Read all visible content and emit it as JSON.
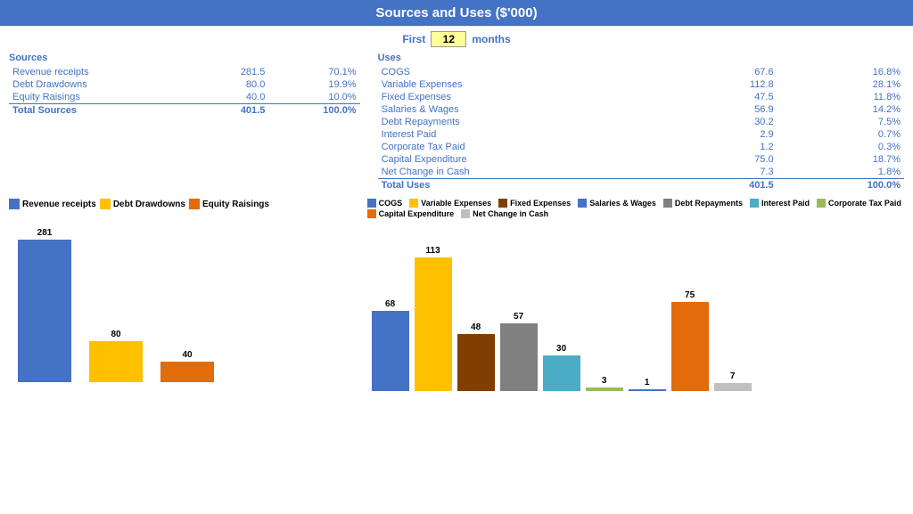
{
  "title": "Sources and Uses ($'000)",
  "months_label_first": "First",
  "months_value": "12",
  "months_label_after": "months",
  "sources": {
    "title": "Sources",
    "rows": [
      {
        "label": "Revenue receipts",
        "value": "281.5",
        "pct": "70.1%"
      },
      {
        "label": "Debt Drawdowns",
        "value": "80.0",
        "pct": "19.9%"
      },
      {
        "label": "Equity Raisings",
        "value": "40.0",
        "pct": "10.0%"
      }
    ],
    "total_label": "Total Sources",
    "total_value": "401.5",
    "total_pct": "100.0%"
  },
  "uses": {
    "title": "Uses",
    "rows": [
      {
        "label": "COGS",
        "value": "67.6",
        "pct": "16.8%"
      },
      {
        "label": "Variable Expenses",
        "value": "112.8",
        "pct": "28.1%"
      },
      {
        "label": "Fixed Expenses",
        "value": "47.5",
        "pct": "11.8%"
      },
      {
        "label": "Salaries & Wages",
        "value": "56.9",
        "pct": "14.2%"
      },
      {
        "label": "Debt Repayments",
        "value": "30.2",
        "pct": "7.5%"
      },
      {
        "label": "Interest Paid",
        "value": "2.9",
        "pct": "0.7%"
      },
      {
        "label": "Corporate Tax Paid",
        "value": "1.2",
        "pct": "0.3%"
      },
      {
        "label": "Capital Expenditure",
        "value": "75.0",
        "pct": "18.7%"
      },
      {
        "label": "Net Change in Cash",
        "value": "7.3",
        "pct": "1.8%"
      }
    ],
    "total_label": "Total Uses",
    "total_value": "401.5",
    "total_pct": "100.0%"
  },
  "sources_chart": {
    "legend": [
      {
        "label": "Revenue receipts",
        "color": "#4472C4"
      },
      {
        "label": "Debt Drawdowns",
        "color": "#FFC000"
      },
      {
        "label": "Equity Raisings",
        "color": "#E26B0A"
      }
    ],
    "bars": [
      {
        "label": "281",
        "value": 281,
        "color": "#4472C4"
      },
      {
        "label": "80",
        "value": 80,
        "color": "#FFC000"
      },
      {
        "label": "40",
        "value": 40,
        "color": "#E26B0A"
      }
    ]
  },
  "uses_chart": {
    "legend": [
      {
        "label": "COGS",
        "color": "#4472C4"
      },
      {
        "label": "Variable Expenses",
        "color": "#FFC000"
      },
      {
        "label": "Fixed Expenses",
        "color": "#7F3F00"
      },
      {
        "label": "Salaries & Wages",
        "color": "#4472C4"
      },
      {
        "label": "Debt Repayments",
        "color": "#808080"
      },
      {
        "label": "Interest Paid",
        "color": "#4BACC6"
      },
      {
        "label": "Corporate Tax Paid",
        "color": "#9BBB59"
      },
      {
        "label": "Capital Expenditure",
        "color": "#E26B0A"
      },
      {
        "label": "Net Change in Cash",
        "color": "#BFBFBF"
      }
    ],
    "bars": [
      {
        "label": "68",
        "value": 68,
        "color": "#4472C4"
      },
      {
        "label": "113",
        "value": 113,
        "color": "#FFC000"
      },
      {
        "label": "48",
        "value": 48,
        "color": "#7F3F00"
      },
      {
        "label": "57",
        "value": 57,
        "color": "#808080"
      },
      {
        "label": "30",
        "value": 30,
        "color": "#4BACC6"
      },
      {
        "label": "3",
        "value": 3,
        "color": "#9BBB59"
      },
      {
        "label": "1",
        "value": 1,
        "color": "#4472C4"
      },
      {
        "label": "75",
        "value": 75,
        "color": "#E26B0A"
      },
      {
        "label": "7",
        "value": 7,
        "color": "#BFBFBF"
      }
    ]
  }
}
